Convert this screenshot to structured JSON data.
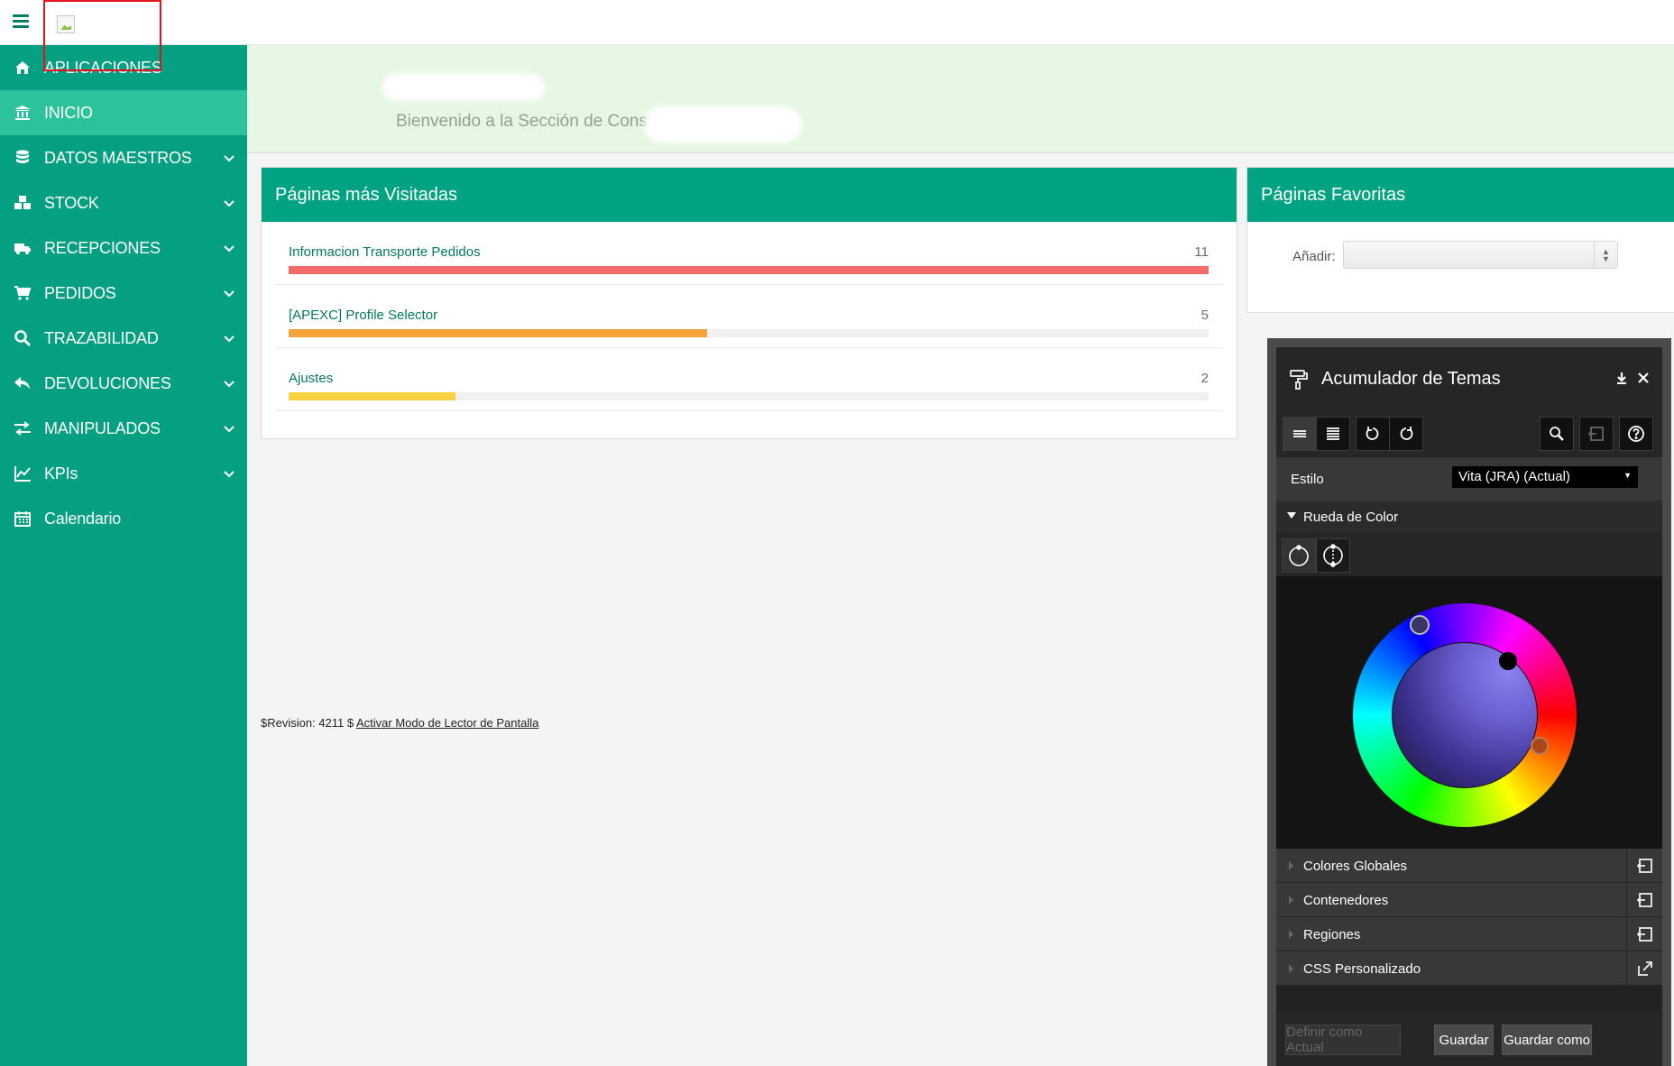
{
  "header": {
    "menu_icon": "hamburger-icon"
  },
  "sidebar": {
    "items": [
      {
        "label": "APLICACIONES",
        "icon": "home-icon",
        "expandable": false,
        "active": false
      },
      {
        "label": "INICIO",
        "icon": "bank-icon",
        "expandable": false,
        "active": true
      },
      {
        "label": "DATOS MAESTROS",
        "icon": "database-icon",
        "expandable": true,
        "active": false
      },
      {
        "label": "STOCK",
        "icon": "cubes-icon",
        "expandable": true,
        "active": false
      },
      {
        "label": "RECEPCIONES",
        "icon": "truck-icon",
        "expandable": true,
        "active": false
      },
      {
        "label": "PEDIDOS",
        "icon": "cart-icon",
        "expandable": true,
        "active": false
      },
      {
        "label": "TRAZABILIDAD",
        "icon": "search-icon",
        "expandable": true,
        "active": false
      },
      {
        "label": "DEVOLUCIONES",
        "icon": "reply-icon",
        "expandable": true,
        "active": false
      },
      {
        "label": "MANIPULADOS",
        "icon": "exchange-icon",
        "expandable": true,
        "active": false
      },
      {
        "label": "KPIs",
        "icon": "line-chart-icon",
        "expandable": true,
        "active": false
      },
      {
        "label": "Calendario",
        "icon": "calendar-icon",
        "expandable": false,
        "active": false
      }
    ]
  },
  "hero": {
    "subtitle": "Bienvenido a la Sección de Consu"
  },
  "visited": {
    "title": "Páginas más Visitadas",
    "rows": [
      {
        "label": "Informacion Transporte Pedidos",
        "count": "11",
        "fraction": 1.0,
        "color": "#f26a6a"
      },
      {
        "label": "[APEXC] Profile Selector",
        "count": "5",
        "fraction": 0.4545,
        "color": "#f5a43a"
      },
      {
        "label": "Ajustes",
        "count": "2",
        "fraction": 0.1818,
        "color": "#f8d140"
      }
    ]
  },
  "favorites": {
    "title": "Páginas Favoritas",
    "add_label": "Añadir:",
    "add_value": ""
  },
  "footer": {
    "revision": "$Revision: 4211 $",
    "screen_reader_link": "Activar Modo de Lector de Pantalla"
  },
  "theme_roller": {
    "title": "Acumulador de Temas",
    "style_label": "Estilo",
    "style_value": "Vita (JRA) (Actual)",
    "color_wheel_label": "Rueda de Color",
    "sections": [
      {
        "label": "Colores Globales",
        "icon": "reset-section-icon"
      },
      {
        "label": "Contenedores",
        "icon": "reset-section-icon"
      },
      {
        "label": "Regiones",
        "icon": "reset-section-icon"
      },
      {
        "label": "CSS Personalizado",
        "icon": "open-external-icon"
      }
    ],
    "buttons": {
      "set_current": "Definir como Actual",
      "save": "Guardar",
      "save_as": "Guardar como"
    },
    "colors": {
      "knob_1": "#3b3566",
      "knob_2": "#000000",
      "knob_3": "#a8471a"
    }
  }
}
